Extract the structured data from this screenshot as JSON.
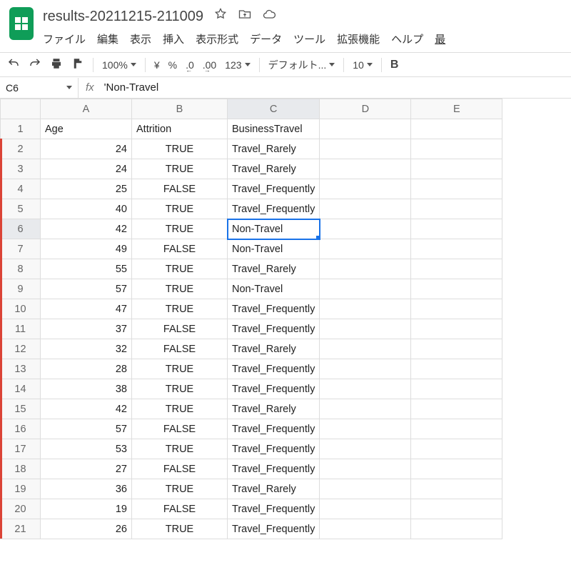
{
  "doc": {
    "title": "results-20211215-211009"
  },
  "menu": {
    "file": "ファイル",
    "edit": "編集",
    "view": "表示",
    "insert": "挿入",
    "format": "表示形式",
    "data": "データ",
    "tools": "ツール",
    "extensions": "拡張機能",
    "help": "ヘルプ",
    "last": "最"
  },
  "toolbar": {
    "zoom": "100%",
    "currency": "¥",
    "percent": "%",
    "dec0": ".0",
    "dec00": ".00",
    "numfmt": "123",
    "font": "デフォルト...",
    "fontsize": "10",
    "bold": "B"
  },
  "namebox": {
    "cell": "C6"
  },
  "formula": {
    "value": "'Non-Travel"
  },
  "cols": [
    "A",
    "B",
    "C",
    "D",
    "E"
  ],
  "headers": {
    "A": "Age",
    "B": "Attrition",
    "C": "BusinessTravel"
  },
  "rows": [
    {
      "n": 1,
      "A": "Age",
      "B": "Attrition",
      "C": "BusinessTravel"
    },
    {
      "n": 2,
      "A": "24",
      "B": "TRUE",
      "C": "Travel_Rarely",
      "red": true
    },
    {
      "n": 3,
      "A": "24",
      "B": "TRUE",
      "C": "Travel_Rarely",
      "red": true
    },
    {
      "n": 4,
      "A": "25",
      "B": "FALSE",
      "C": "Travel_Frequently",
      "red": true
    },
    {
      "n": 5,
      "A": "40",
      "B": "TRUE",
      "C": "Travel_Frequently",
      "red": true
    },
    {
      "n": 6,
      "A": "42",
      "B": "TRUE",
      "C": "Non-Travel",
      "red": true,
      "sel": true
    },
    {
      "n": 7,
      "A": "49",
      "B": "FALSE",
      "C": "Non-Travel",
      "red": true
    },
    {
      "n": 8,
      "A": "55",
      "B": "TRUE",
      "C": "Travel_Rarely",
      "red": true
    },
    {
      "n": 9,
      "A": "57",
      "B": "TRUE",
      "C": "Non-Travel",
      "red": true
    },
    {
      "n": 10,
      "A": "47",
      "B": "TRUE",
      "C": "Travel_Frequently",
      "red": true
    },
    {
      "n": 11,
      "A": "37",
      "B": "FALSE",
      "C": "Travel_Frequently",
      "red": true
    },
    {
      "n": 12,
      "A": "32",
      "B": "FALSE",
      "C": "Travel_Rarely",
      "red": true
    },
    {
      "n": 13,
      "A": "28",
      "B": "TRUE",
      "C": "Travel_Frequently",
      "red": true
    },
    {
      "n": 14,
      "A": "38",
      "B": "TRUE",
      "C": "Travel_Frequently",
      "red": true
    },
    {
      "n": 15,
      "A": "42",
      "B": "TRUE",
      "C": "Travel_Rarely",
      "red": true
    },
    {
      "n": 16,
      "A": "57",
      "B": "FALSE",
      "C": "Travel_Frequently",
      "red": true
    },
    {
      "n": 17,
      "A": "53",
      "B": "TRUE",
      "C": "Travel_Frequently",
      "red": true
    },
    {
      "n": 18,
      "A": "27",
      "B": "FALSE",
      "C": "Travel_Frequently",
      "red": true
    },
    {
      "n": 19,
      "A": "36",
      "B": "TRUE",
      "C": "Travel_Rarely",
      "red": true
    },
    {
      "n": 20,
      "A": "19",
      "B": "FALSE",
      "C": "Travel_Frequently",
      "red": true
    },
    {
      "n": 21,
      "A": "26",
      "B": "TRUE",
      "C": "Travel_Frequently",
      "red": true
    }
  ]
}
